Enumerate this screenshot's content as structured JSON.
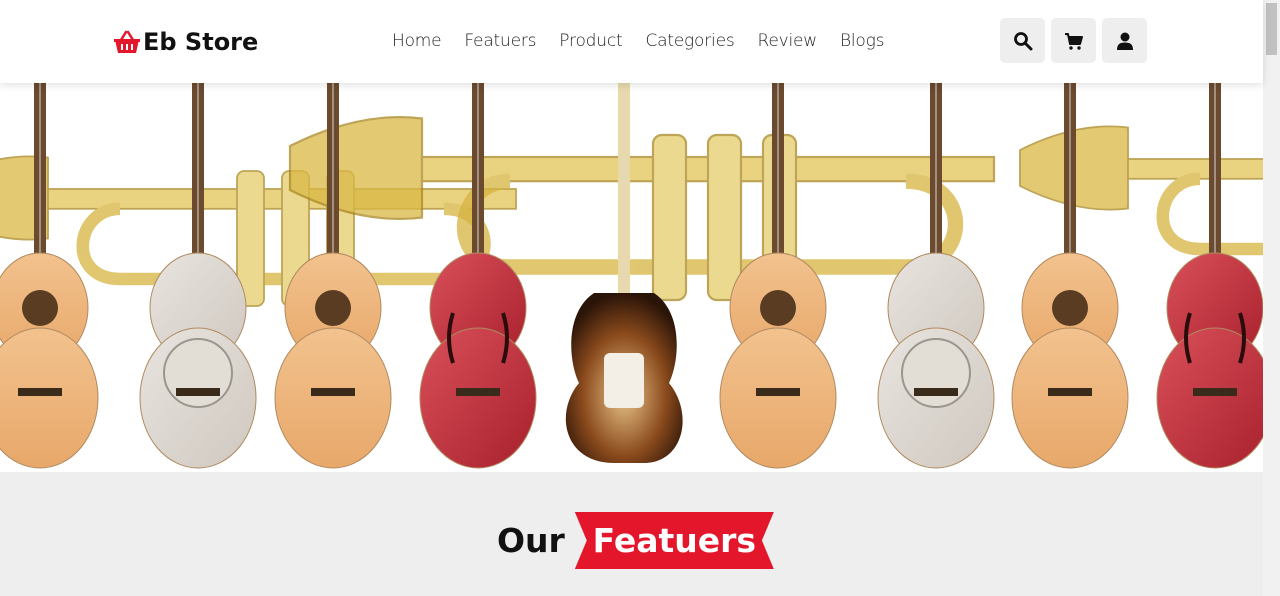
{
  "brand": {
    "name": "Eb Store",
    "icon": "basket-icon",
    "color": "#e3162b"
  },
  "nav": {
    "items": [
      {
        "label": "Home"
      },
      {
        "label": "Featuers"
      },
      {
        "label": "Product"
      },
      {
        "label": "Categories"
      },
      {
        "label": "Review"
      },
      {
        "label": "Blogs"
      }
    ]
  },
  "header_icons": [
    "search-icon",
    "cart-icon",
    "user-icon"
  ],
  "features": {
    "heading_plain": "Our",
    "heading_highlight": "Featuers",
    "accent": "#e3162b"
  }
}
